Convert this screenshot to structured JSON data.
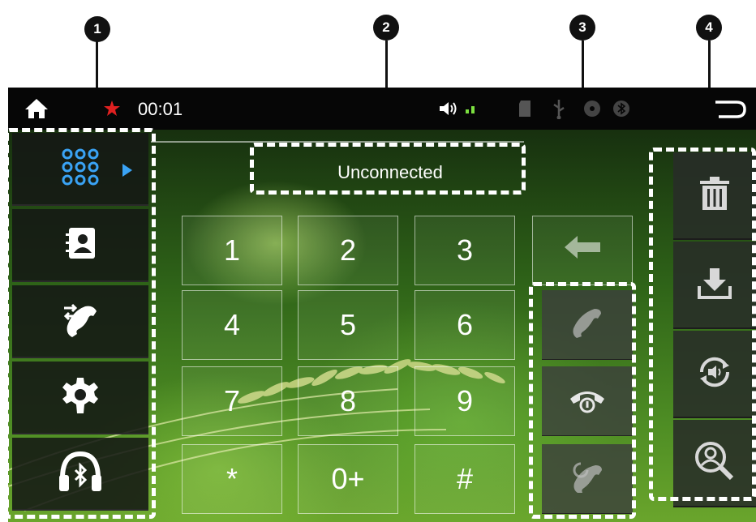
{
  "callouts": [
    "1",
    "2",
    "3",
    "4"
  ],
  "status_bar": {
    "time": "00:01",
    "icons": [
      "home-icon",
      "record-icon",
      "volume-icon",
      "signal-icon",
      "sd-card-icon",
      "usb-icon",
      "disc-icon",
      "bluetooth-icon",
      "back-icon"
    ]
  },
  "left_nav": {
    "items": [
      {
        "name": "dialpad",
        "icon": "dialpad-icon",
        "active": true
      },
      {
        "name": "contacts",
        "icon": "contacts-icon"
      },
      {
        "name": "call-log",
        "icon": "call-log-icon"
      },
      {
        "name": "settings",
        "icon": "gear-icon"
      },
      {
        "name": "bluetooth-audio",
        "icon": "bluetooth-headphones-icon"
      }
    ],
    "accent": "#3aa3f5"
  },
  "display": {
    "status": "Unconnected"
  },
  "keypad": {
    "keys": [
      "1",
      "2",
      "3",
      "4",
      "5",
      "6",
      "7",
      "8",
      "9",
      "*",
      "0+",
      "#"
    ],
    "backspace_icon": "backspace-icon"
  },
  "call_buttons": [
    {
      "name": "call",
      "icon": "phone-icon"
    },
    {
      "name": "hang-up",
      "icon": "hang-up-icon"
    },
    {
      "name": "redial",
      "icon": "redial-icon"
    }
  ],
  "right_panel": [
    {
      "name": "delete",
      "icon": "trash-icon"
    },
    {
      "name": "download",
      "icon": "download-icon"
    },
    {
      "name": "audio-transfer",
      "icon": "audio-transfer-icon"
    },
    {
      "name": "search-contact",
      "icon": "search-contact-icon"
    }
  ]
}
